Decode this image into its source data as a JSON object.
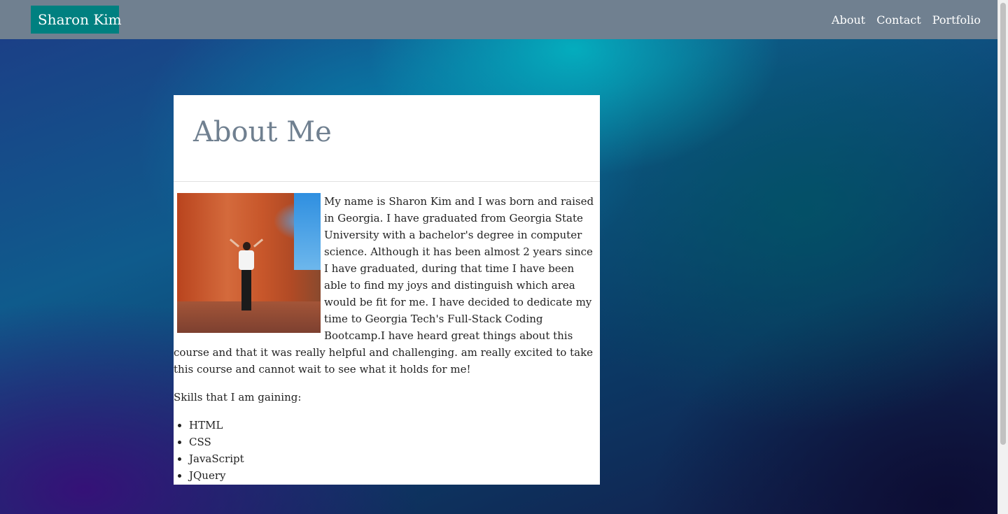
{
  "navbar": {
    "brand": "Sharon Kim",
    "links": [
      {
        "label": "About"
      },
      {
        "label": "Contact"
      },
      {
        "label": "Portfolio"
      }
    ],
    "background_color": "#708090",
    "brand_color": "#008080"
  },
  "about": {
    "title": "About Me",
    "bio": "My name is Sharon Kim and I was born and raised in Georgia. I have graduated from Georgia State University with a bachelor's degree in computer science. Although it has been almost 2 years since I have graduated, during that time I have been able to find my joys and distinguish which area would be fit for me. I have decided to dedicate my time to Georgia Tech's Full-Stack Coding Bootcamp.I have heard great things about this course and that it was really helpful and challenging. am really excited to take this course and cannot wait to see what it holds for me!",
    "skills_label": "Skills that I am gaining:",
    "skills": [
      "HTML",
      "CSS",
      "JavaScript",
      "JQuery"
    ]
  }
}
